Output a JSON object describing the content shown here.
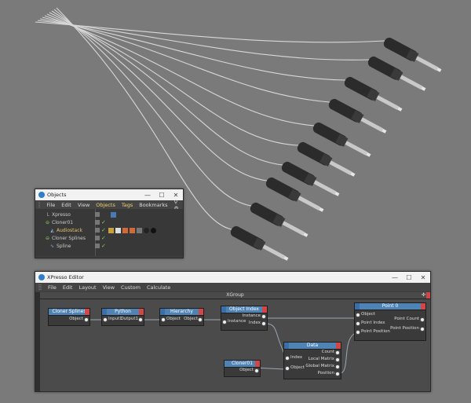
{
  "objects_window": {
    "title": "Objects",
    "menu": [
      "File",
      "Edit",
      "View",
      "Objects",
      "Tags",
      "Bookmarks"
    ],
    "items": [
      {
        "name": "Xpresso"
      },
      {
        "name": "Cloner01"
      },
      {
        "name": "Audiostack"
      },
      {
        "name": "Cloner Splines"
      },
      {
        "name": "Spline"
      }
    ]
  },
  "xpresso_window": {
    "title": "XPresso Editor",
    "menu": [
      "File",
      "Edit",
      "Layout",
      "View",
      "Custom",
      "Calculate"
    ],
    "group_title": "XGroup",
    "nodes": {
      "cloner_splines": {
        "title": "Cloner Splines",
        "out": "Object"
      },
      "python": {
        "title": "Python",
        "in": "Input1",
        "out": "Output1"
      },
      "hierarchy": {
        "title": "Hierarchy",
        "in": "Object",
        "out": "Object"
      },
      "object_index": {
        "title": "Object Index",
        "in": "Instance",
        "out1": "Instance",
        "out2": "Index"
      },
      "data": {
        "title": "Data",
        "in1": "Index",
        "in2": "Object",
        "out1": "Count",
        "out2": "Local Matrix",
        "out3": "Global Matrix",
        "out4": "Position"
      },
      "cloner01": {
        "title": "Cloner01",
        "out": "Object"
      },
      "point": {
        "title": "Point 0",
        "in1": "Object",
        "in2": "Point Index",
        "in3": "Point Position",
        "out1": "Point Count",
        "out2": "Point Position"
      }
    }
  },
  "colors": {
    "node_header": "#4f83b4",
    "viewport_bg": "#7a7a7a",
    "highlight": "#f0d270"
  }
}
